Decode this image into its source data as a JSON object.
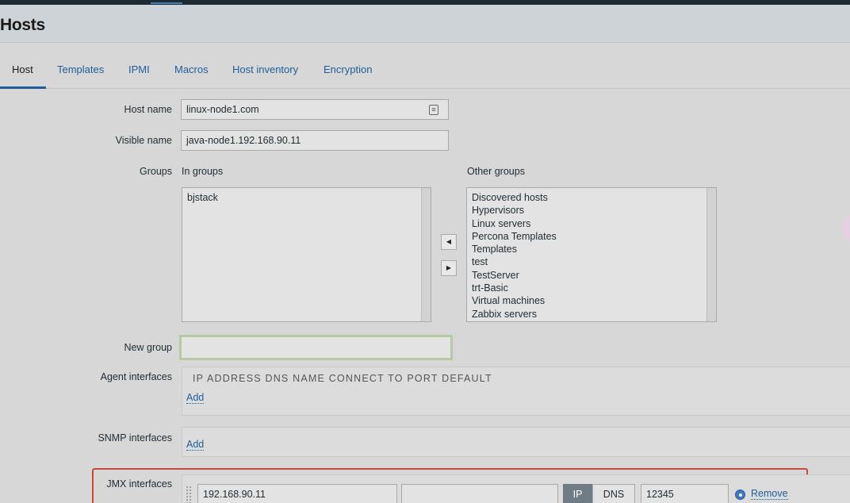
{
  "page": {
    "title": "Hosts"
  },
  "tabs": [
    {
      "label": "Host"
    },
    {
      "label": "Templates"
    },
    {
      "label": "IPMI"
    },
    {
      "label": "Macros"
    },
    {
      "label": "Host inventory"
    },
    {
      "label": "Encryption"
    }
  ],
  "form": {
    "host_name": {
      "label": "Host name",
      "value": "linux-node1.com"
    },
    "visible_name": {
      "label": "Visible name",
      "value": "java-node1.192.168.90.11"
    },
    "groups": {
      "label": "Groups",
      "in_groups_caption": "In groups",
      "other_groups_caption": "Other groups",
      "in_groups": [
        "bjstack"
      ],
      "other_groups": [
        "Discovered hosts",
        "Hypervisors",
        "Linux servers",
        "Percona Templates",
        "Templates",
        "test",
        "TestServer",
        "trt-Basic",
        "Virtual machines",
        "Zabbix servers"
      ],
      "move_left_symbol": "◀",
      "move_right_symbol": "▶"
    },
    "new_group": {
      "label": "New group",
      "value": ""
    },
    "agent_interfaces": {
      "label": "Agent interfaces",
      "columns": "IP ADDRESS DNS NAME CONNECT TO PORT DEFAULT",
      "add_label": "Add"
    },
    "snmp_interfaces": {
      "label": "SNMP interfaces",
      "add_label": "Add"
    },
    "jmx_interfaces": {
      "label": "JMX interfaces",
      "ip": "192.168.90.11",
      "dns": "",
      "connect_ip": "IP",
      "connect_dns": "DNS",
      "port": "12345",
      "remove_label": "Remove"
    }
  },
  "colors": {
    "accent": "#1f5e99",
    "highlight": "#c64a3b",
    "active_segment": "#6f7c85"
  },
  "icons": {
    "host_name_field": "clipboard-icon"
  }
}
